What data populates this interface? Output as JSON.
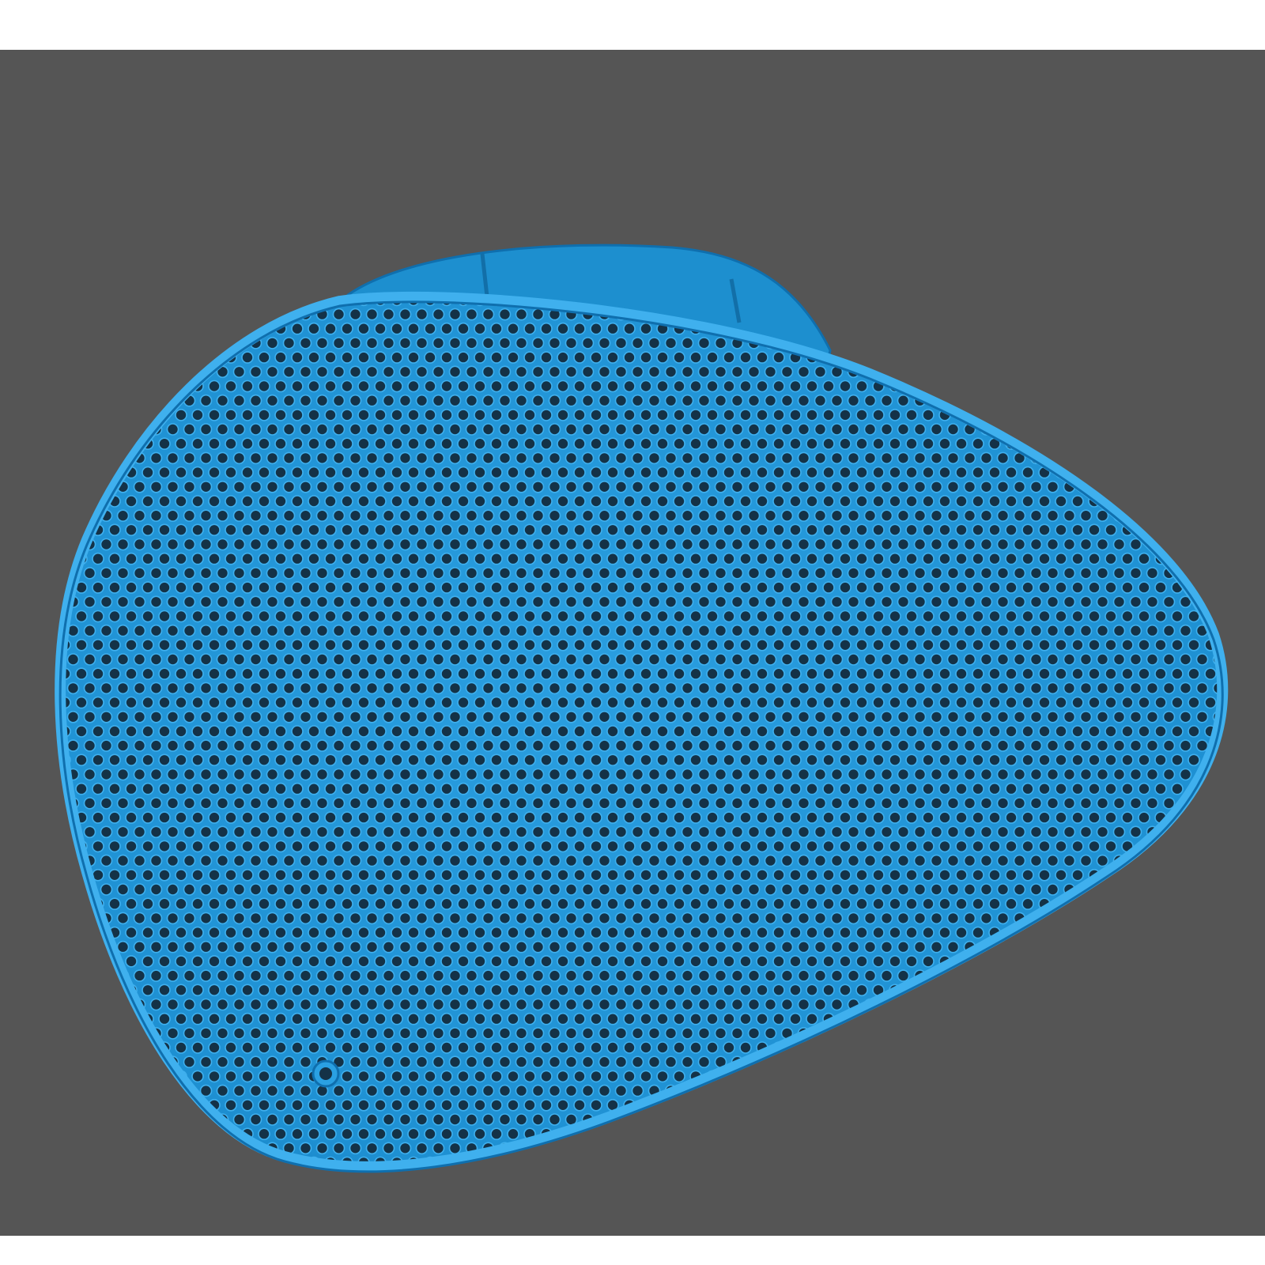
{
  "scene": {
    "subject": "perforated-speaker-grille",
    "colors": {
      "page_background": "#ffffff",
      "backdrop": "#555555",
      "grille": "#1f94d6",
      "grille_highlight": "#3fb0ee",
      "grille_shadow": "#0f6fae",
      "hole": "#143247"
    }
  }
}
